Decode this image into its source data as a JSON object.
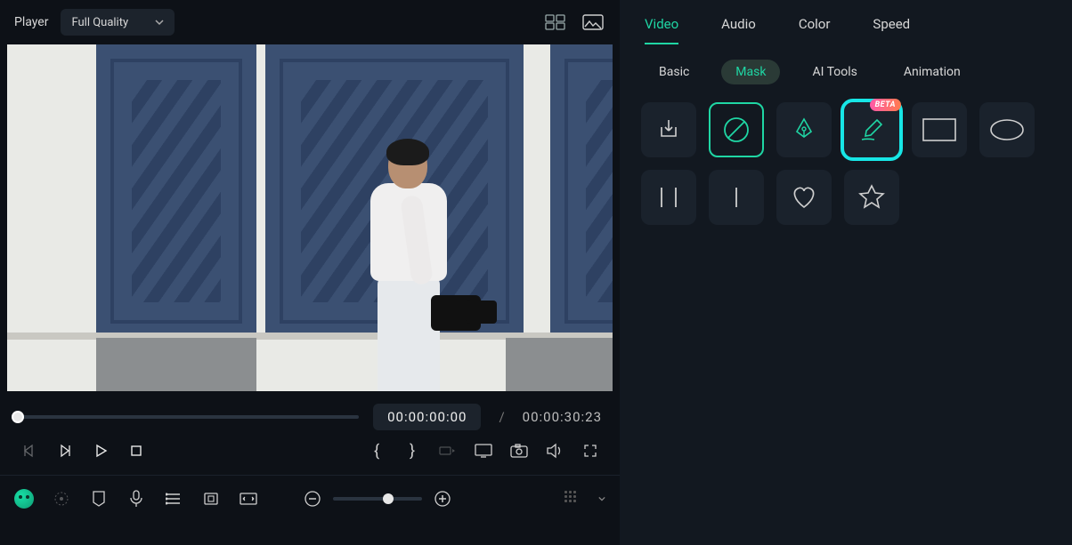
{
  "topbar": {
    "player_label": "Player",
    "quality_value": "Full Quality"
  },
  "playback": {
    "current_time": "00:00:00:00",
    "separator": "/",
    "duration": "00:00:30:23"
  },
  "main_tabs": [
    {
      "label": "Video",
      "active": true
    },
    {
      "label": "Audio",
      "active": false
    },
    {
      "label": "Color",
      "active": false
    },
    {
      "label": "Speed",
      "active": false
    }
  ],
  "sub_tabs": [
    {
      "label": "Basic",
      "active": false
    },
    {
      "label": "Mask",
      "active": true
    },
    {
      "label": "AI Tools",
      "active": false
    },
    {
      "label": "Animation",
      "active": false
    }
  ],
  "mask_shapes": [
    {
      "name": "import-mask",
      "icon": "import"
    },
    {
      "name": "none-mask",
      "icon": "none",
      "outlined": true
    },
    {
      "name": "pen-mask",
      "icon": "pen"
    },
    {
      "name": "brush-mask",
      "icon": "brush",
      "highlight": true,
      "badge": "BETA"
    },
    {
      "name": "rectangle-mask",
      "icon": "rect"
    },
    {
      "name": "ellipse-mask",
      "icon": "ellipse"
    },
    {
      "name": "split-mask",
      "icon": "split"
    },
    {
      "name": "single-line-mask",
      "icon": "vline"
    },
    {
      "name": "heart-mask",
      "icon": "heart"
    },
    {
      "name": "star-mask",
      "icon": "star"
    }
  ],
  "colors": {
    "accent": "#1fd6a4",
    "highlight": "#17e6e6",
    "beta_badge_from": "#ff5aa9",
    "beta_badge_to": "#ff7b4d"
  }
}
